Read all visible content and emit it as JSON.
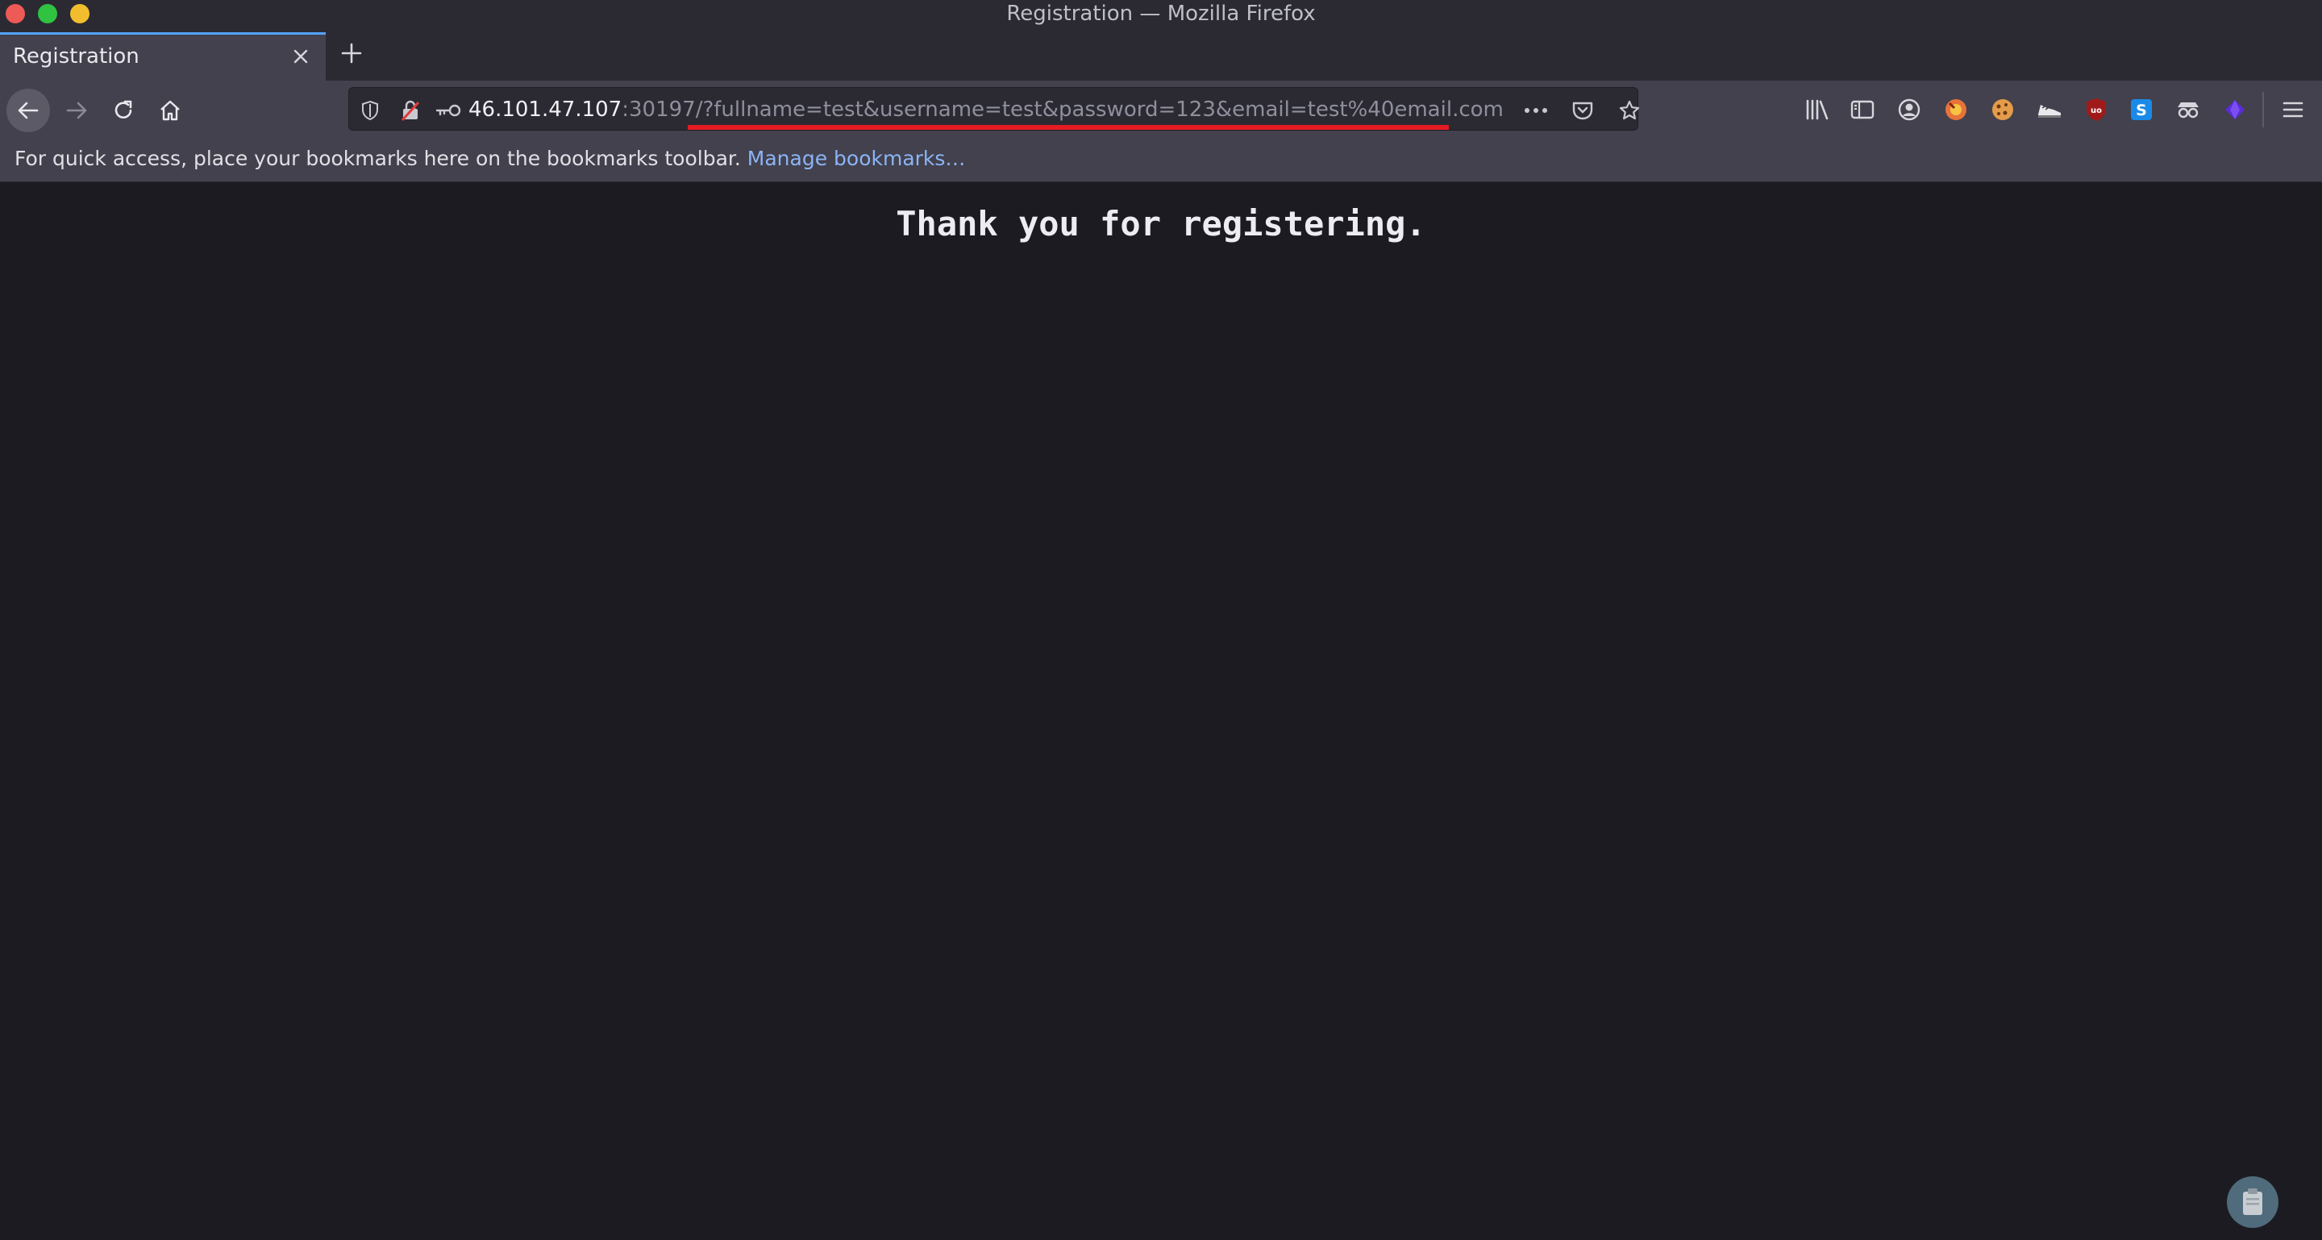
{
  "window": {
    "title": "Registration — Mozilla Firefox"
  },
  "tabs": [
    {
      "label": "Registration",
      "active": true
    }
  ],
  "urlbar": {
    "host": "46.101.47.107",
    "rest": ":30197/?fullname=test&username=test&password=123&email=test%40email.com"
  },
  "bookmarks": {
    "message": "For quick access, place your bookmarks here on the bookmarks toolbar.",
    "manage_link": "Manage bookmarks…"
  },
  "page": {
    "message": "Thank you for registering."
  },
  "colors": {
    "accent": "#55a3ff",
    "underline": "#e41b23",
    "page_background": "#1c1b22"
  },
  "icons": [
    "back-arrow-icon",
    "forward-arrow-icon",
    "reload-icon",
    "home-icon",
    "shield-icon",
    "insecure-lock-icon",
    "key-icon",
    "more-dots-icon",
    "pocket-icon",
    "star-icon",
    "library-icon",
    "sidebar-icon",
    "account-icon",
    "extension-icons",
    "hamburger-menu-icon",
    "clipboard-icon"
  ]
}
